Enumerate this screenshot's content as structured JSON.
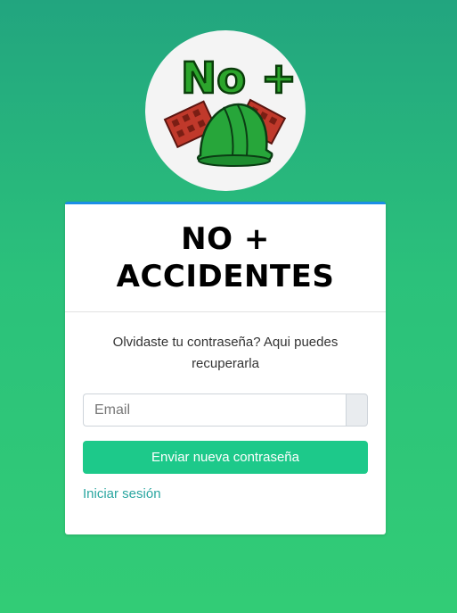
{
  "logo": {
    "text": "No +",
    "icon": "helmet-bricks-logo"
  },
  "card": {
    "title": "NO + ACCIDENTES",
    "message": "Olvidaste tu contraseña? Aqui puedes recuperarla",
    "email": {
      "placeholder": "Email",
      "value": ""
    },
    "submit_label": "Enviar nueva contraseña",
    "login_link": "Iniciar sesión"
  },
  "colors": {
    "background_top": "#22a57f",
    "background_bottom": "#32cc76",
    "card_accent": "#1b8ee6",
    "button": "#1dc98a",
    "link": "#2aa6a0"
  }
}
